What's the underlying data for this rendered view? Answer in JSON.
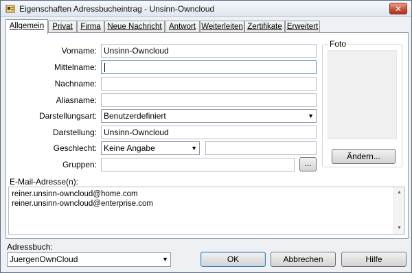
{
  "window": {
    "title": "Eigenschaften Adressbucheintrag - Unsinn-Owncloud",
    "close_symbol": "✕"
  },
  "tabs": [
    {
      "label": "Allgemein"
    },
    {
      "label": "Privat"
    },
    {
      "label": "Firma"
    },
    {
      "label": "Neue Nachricht"
    },
    {
      "label": "Antwort"
    },
    {
      "label": "Weiterleiten"
    },
    {
      "label": "Zertifikate"
    },
    {
      "label": "Erweitert"
    }
  ],
  "form": {
    "vorname_label": "Vorname:",
    "vorname_value": "Unsinn-Owncloud",
    "mittelname_label": "Mittelname:",
    "mittelname_value": "",
    "nachname_label": "Nachname:",
    "nachname_value": "",
    "aliasname_label": "Aliasname:",
    "aliasname_value": "",
    "darstellungsart_label": "Darstellungsart:",
    "darstellungsart_value": "Benutzerdefiniert",
    "darstellung_label": "Darstellung:",
    "darstellung_value": "Unsinn-Owncloud",
    "geschlecht_label": "Geschlecht:",
    "geschlecht_value": "Keine Angabe",
    "geschlecht_extra_value": "",
    "gruppen_label": "Gruppen:",
    "gruppen_value": "",
    "gruppen_button": "..."
  },
  "photo": {
    "title": "Foto",
    "change_button": "Ändern..."
  },
  "email": {
    "label": "E-Mail-Adresse(n):",
    "addresses": [
      "reiner.unsinn-owncloud@home.com",
      "reiner.unsinn-owncloud@enterprise.com"
    ]
  },
  "footer": {
    "addressbook_label": "Adressbuch:",
    "addressbook_value": "JuergenOwnCloud",
    "ok_button": "OK",
    "cancel_button": "Abbrechen",
    "help_button": "Hilfe"
  }
}
